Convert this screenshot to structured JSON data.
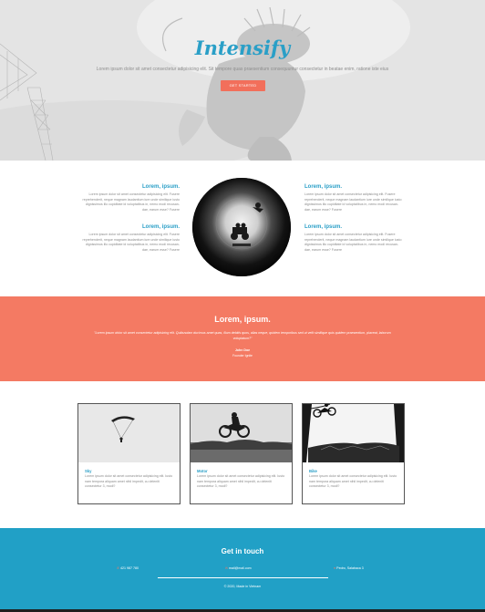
{
  "hero": {
    "title": "Intensify",
    "subtitle": "Lorem ipsum dolor sit amet consectetur adipisicing elit. Sit tempore quas praesentium consequuntur consectetur in beatae enim, ratione iste eius",
    "cta_label": "GET STARTED"
  },
  "features": {
    "left": [
      {
        "heading": "Lorem, ipsum.",
        "text": "Lorem ipsum dolor sit amet consectetur adipisicing elit. Fusere reprehenderit, neque magnam laudantium iure unde similique iusto dignissimos illo cupiditate id voluptatibus in, nemo modi recusan- dae, earum esse? Fusere"
      },
      {
        "heading": "Lorem, ipsum.",
        "text": "Lorem ipsum dolor sit amet consectetur adipisicing elit. Fusere reprehenderit, neque magnam laudantium iure unde similique iusto dignissimos illo cupiditate id voluptatibus in, nemo modi recusan- dae, earum esse? Fusere"
      }
    ],
    "right": [
      {
        "heading": "Lorem, ipsum.",
        "text": "Lorem ipsum dolor sit amet consectetur adipisicing elit. Fusere reprehenderit, neque magnam laudantium iure unde similique iusto dignissimos illo cupiditate id voluptatibus in, nemo modi recusan- dae, earum esse? Fusere"
      },
      {
        "heading": "Lorem, ipsum.",
        "text": "Lorem ipsum dolor sit amet consectetur adipisicing elit. Fusere reprehenderit, neque magnam laudantium iure unde similique iusto dignissimos illo cupiditate id voluptatibus in, nemo modi recusan- dae, earum esse? Fusere"
      }
    ]
  },
  "testimonial": {
    "title": "Lorem, ipsum.",
    "quote": "\"Lorem ipsum dolor sit amet consectetur adipisicing elit. Quibusdam ducimus amet quas, illum debitis quos, alias neque, quidem temporibus sed ut velit similique quis quidem praesentium, placeat, laborum voluptatum?\"",
    "author": "John Doe",
    "role": "Founder Ignite"
  },
  "cards": [
    {
      "title": "Sky",
      "text": "Lorem ipsum dolor sit amet consectetur adipisicing elit. Iusto nam tempora aliquam amet nihil impedit, cu deleniti consectetur 3, modi?"
    },
    {
      "title": "Motor",
      "text": "Lorem ipsum dolor sit amet consectetur adipisicing elit. Iusto nam tempora aliquam amet nihil impedit, cu deleniti consectetur 3, modi?"
    },
    {
      "title": "Bike",
      "text": "Lorem ipsum dolor sit amet consectetur adipisicing elit. Iusto nam tempora aliquam amet nihil impedit, cu deleniti consectetur 3, modi?"
    }
  ],
  "footer": {
    "title": "Get in touch",
    "phone": "421 987 780",
    "phone_icon": "phone-icon",
    "email": "mail@mail.com",
    "email_icon": "mail-icon",
    "address": "Pedro, Salabaca 3",
    "address_icon": "location-pin-icon",
    "copyright": "© 2020, Made in Vietnam"
  },
  "colors": {
    "accent_blue": "#2a9fc7",
    "accent_coral": "#f47a63",
    "footer_blue": "#21a0c6"
  }
}
